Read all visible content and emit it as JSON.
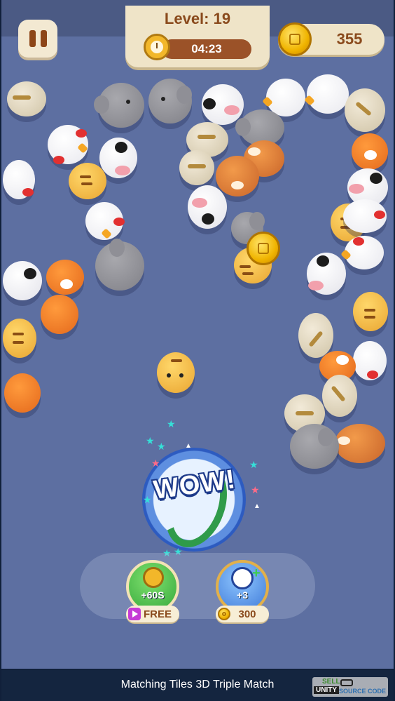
{
  "hud": {
    "level_label": "Level: 19",
    "timer_value": "04:23",
    "coins_value": "355"
  },
  "boosters": {
    "time_label": "+60S",
    "time_price_label": "FREE",
    "shuffle_label": "+3",
    "shuffle_price_label": "300"
  },
  "effect": {
    "wow_text": "WOW!"
  },
  "footer": {
    "title": "Matching Tiles 3D Triple Match"
  },
  "watermark": {
    "sell": "SELL",
    "unity": "UNITY",
    "source_code": "SOURCE CODE"
  },
  "colors": {
    "board": "#5d6fa1",
    "panel": "#efe4c8",
    "accent_brown": "#8a4a1c",
    "footer_bg": "#14253f"
  }
}
